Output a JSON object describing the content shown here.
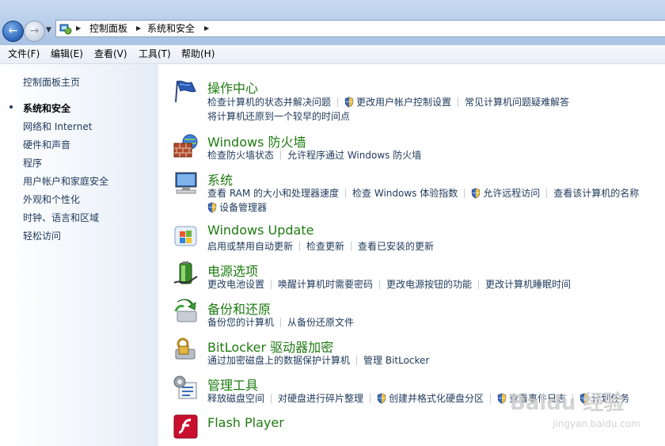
{
  "address": {
    "crumbs": [
      "控制面板",
      "系统和安全"
    ]
  },
  "menu": [
    "文件(F)",
    "编辑(E)",
    "查看(V)",
    "工具(T)",
    "帮助(H)"
  ],
  "sidebar": {
    "home": "控制面板主页",
    "current": "系统和安全",
    "items": [
      "网络和 Internet",
      "硬件和声音",
      "程序",
      "用户帐户和家庭安全",
      "外观和个性化",
      "时钟、语言和区域",
      "轻松访问"
    ]
  },
  "categories": [
    {
      "title": "操作中心",
      "icon": "flag-icon",
      "rows": [
        [
          {
            "label": "检查计算机的状态并解决问题",
            "shield": false
          },
          {
            "label": "更改用户帐户控制设置",
            "shield": true
          },
          {
            "label": "常见计算机问题疑难解答",
            "shield": false
          }
        ],
        [
          {
            "label": "将计算机还原到一个较早的时间点",
            "shield": false
          }
        ]
      ]
    },
    {
      "title": "Windows 防火墙",
      "icon": "firewall-icon",
      "rows": [
        [
          {
            "label": "检查防火墙状态",
            "shield": false
          },
          {
            "label": "允许程序通过 Windows 防火墙",
            "shield": false
          }
        ]
      ]
    },
    {
      "title": "系统",
      "icon": "computer-icon",
      "rows": [
        [
          {
            "label": "查看 RAM 的大小和处理器速度",
            "shield": false
          },
          {
            "label": "检查 Windows 体验指数",
            "shield": false
          },
          {
            "label": "允许远程访问",
            "shield": true
          },
          {
            "label": "查看该计算机的名称",
            "shield": false
          }
        ],
        [
          {
            "label": "设备管理器",
            "shield": true
          }
        ]
      ]
    },
    {
      "title": "Windows Update",
      "icon": "windows-update-icon",
      "rows": [
        [
          {
            "label": "启用或禁用自动更新",
            "shield": false
          },
          {
            "label": "检查更新",
            "shield": false
          },
          {
            "label": "查看已安装的更新",
            "shield": false
          }
        ]
      ]
    },
    {
      "title": "电源选项",
      "icon": "battery-icon",
      "rows": [
        [
          {
            "label": "更改电池设置",
            "shield": false
          },
          {
            "label": "唤醒计算机时需要密码",
            "shield": false
          },
          {
            "label": "更改电源按钮的功能",
            "shield": false
          },
          {
            "label": "更改计算机睡眠时间",
            "shield": false
          }
        ]
      ]
    },
    {
      "title": "备份和还原",
      "icon": "backup-icon",
      "rows": [
        [
          {
            "label": "备份您的计算机",
            "shield": false
          },
          {
            "label": "从备份还原文件",
            "shield": false
          }
        ]
      ]
    },
    {
      "title": "BitLocker 驱动器加密",
      "icon": "bitlocker-icon",
      "rows": [
        [
          {
            "label": "通过加密磁盘上的数据保护计算机",
            "shield": false
          },
          {
            "label": "管理 BitLocker",
            "shield": false
          }
        ]
      ]
    },
    {
      "title": "管理工具",
      "icon": "admin-tools-icon",
      "rows": [
        [
          {
            "label": "释放磁盘空间",
            "shield": false
          },
          {
            "label": "对硬盘进行碎片整理",
            "shield": false
          },
          {
            "label": "创建并格式化硬盘分区",
            "shield": true
          },
          {
            "label": "查看事件日志",
            "shield": true
          },
          {
            "label": "计划任务",
            "shield": true
          }
        ]
      ]
    },
    {
      "title": "Flash Player",
      "icon": "flash-icon",
      "rows": []
    }
  ],
  "watermark": {
    "logo": "Baidu 经验",
    "url": "jingyan.baidu.com"
  }
}
